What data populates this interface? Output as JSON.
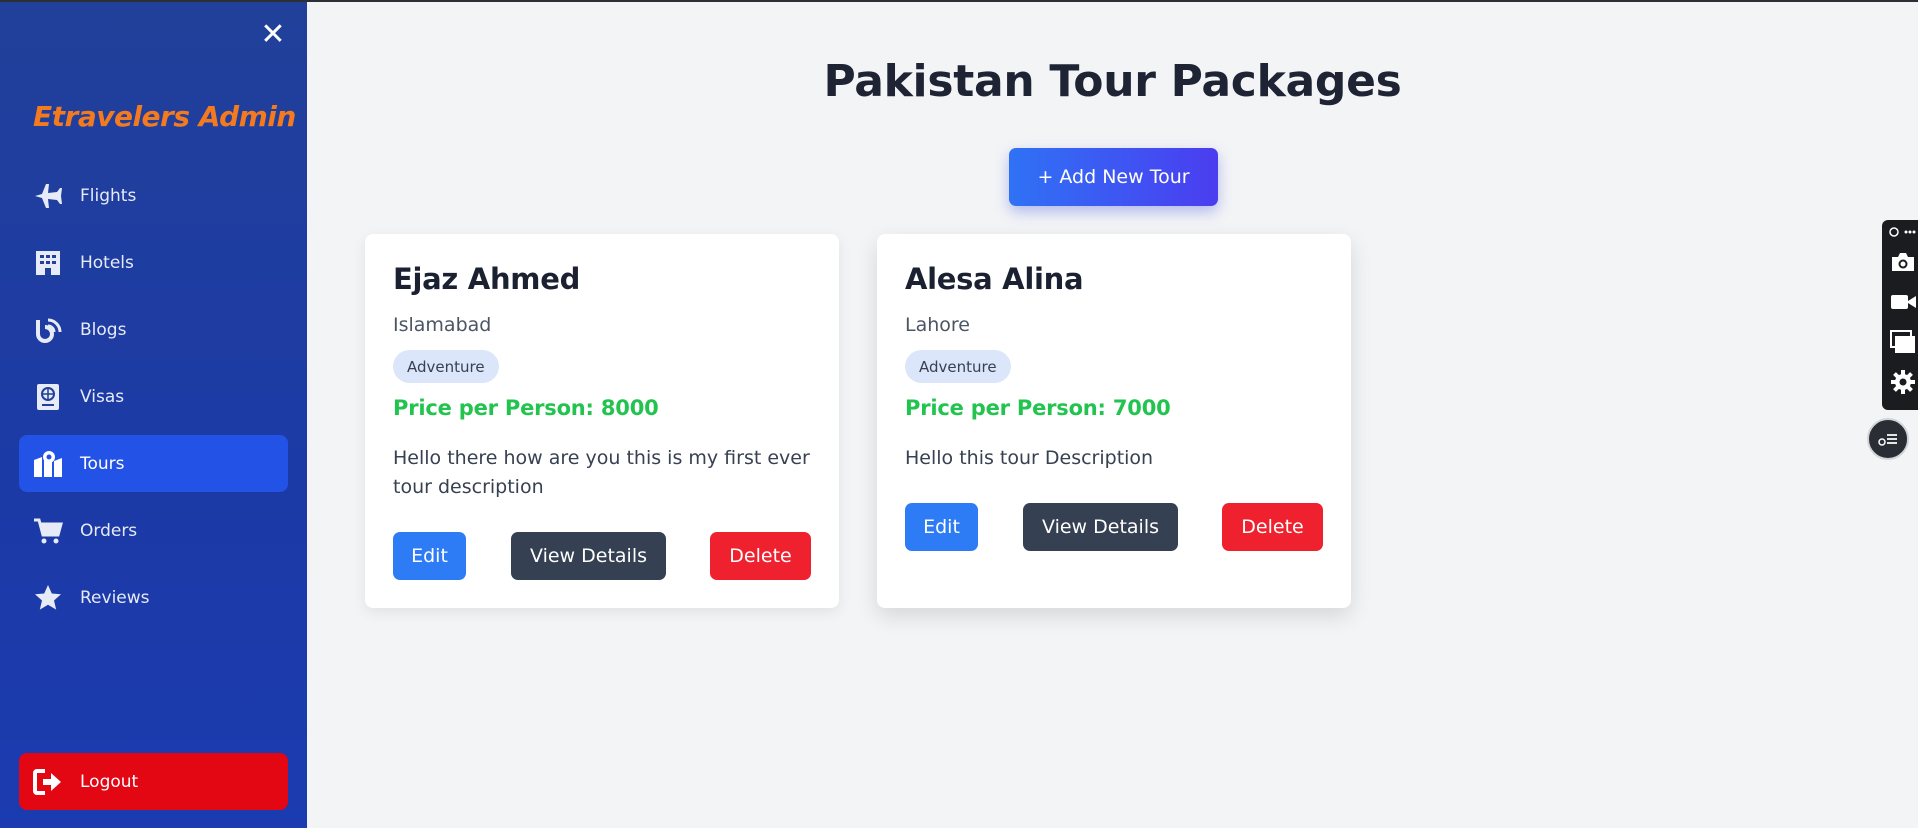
{
  "sidebar": {
    "brand": "Etravelers Admin",
    "close_icon": "close-icon",
    "items": [
      {
        "label": "Flights",
        "icon": "plane-icon"
      },
      {
        "label": "Hotels",
        "icon": "building-icon"
      },
      {
        "label": "Blogs",
        "icon": "blog-icon"
      },
      {
        "label": "Visas",
        "icon": "passport-icon"
      },
      {
        "label": "Tours",
        "icon": "map-location-icon",
        "active": true
      },
      {
        "label": "Orders",
        "icon": "cart-icon"
      },
      {
        "label": "Reviews",
        "icon": "star-icon"
      }
    ],
    "logout": "Logout"
  },
  "main": {
    "title": "Pakistan Tour Packages",
    "add_button": "+ Add New Tour",
    "tours": [
      {
        "name": "Ejaz Ahmed",
        "city": "Islamabad",
        "tag": "Adventure",
        "price": "Price per Person: 8000",
        "description": "Hello there how are you this is my first ever tour description",
        "edit": "Edit",
        "view": "View Details",
        "delete": "Delete"
      },
      {
        "name": "Alesa Alina",
        "city": "Lahore",
        "tag": "Adventure",
        "price": "Price per Person: 7000",
        "description": "Hello this tour Description",
        "edit": "Edit",
        "view": "View Details",
        "delete": "Delete"
      }
    ]
  },
  "colors": {
    "sidebar": "#1c3aa6",
    "brand": "#f47a1f",
    "active": "#2352e6",
    "logout": "#e30613",
    "price": "#22c34e",
    "edit": "#2e7bf6",
    "view": "#354052",
    "delete": "#f0212e"
  }
}
